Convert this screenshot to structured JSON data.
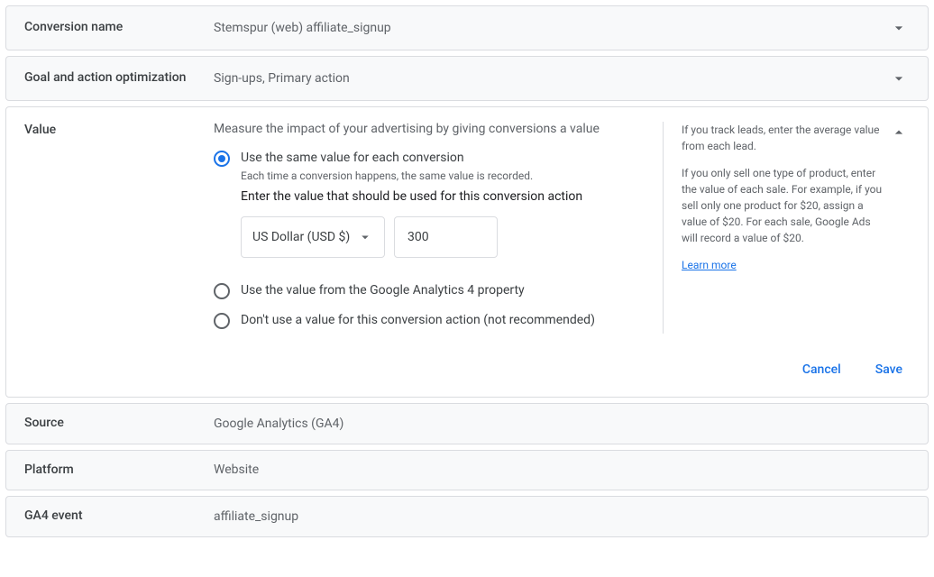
{
  "rows": {
    "conversion_name": {
      "label": "Conversion name",
      "value": "Stemspur (web) affiliate_signup"
    },
    "goal_action": {
      "label": "Goal and action optimization",
      "value": "Sign-ups, Primary action"
    },
    "source": {
      "label": "Source",
      "value": "Google Analytics (GA4)"
    },
    "platform": {
      "label": "Platform",
      "value": "Website"
    },
    "ga4_event": {
      "label": "GA4 event",
      "value": "affiliate_signup"
    }
  },
  "value_panel": {
    "label": "Value",
    "headline": "Measure the impact of your advertising by giving conversions a value",
    "opt_same": {
      "label": "Use the same value for each conversion",
      "sub": "Each time a conversion happens, the same value is recorded.",
      "enter_line": "Enter the value that should be used for this conversion action",
      "currency": "US Dollar (USD $)",
      "amount": "300"
    },
    "opt_ga4": {
      "label": "Use the value from the Google Analytics 4 property"
    },
    "opt_none": {
      "label": "Don't use a value for this conversion action (not recommended)"
    },
    "help": {
      "p1": "If you track leads, enter the average value from each lead.",
      "p2": "If you only sell one type of product, enter the value of each sale. For example, if you sell only one product for $20, assign a value of $20. For each sale, Google Ads will record a value of $20.",
      "learn_more": "Learn more"
    },
    "cancel": "Cancel",
    "save": "Save"
  }
}
